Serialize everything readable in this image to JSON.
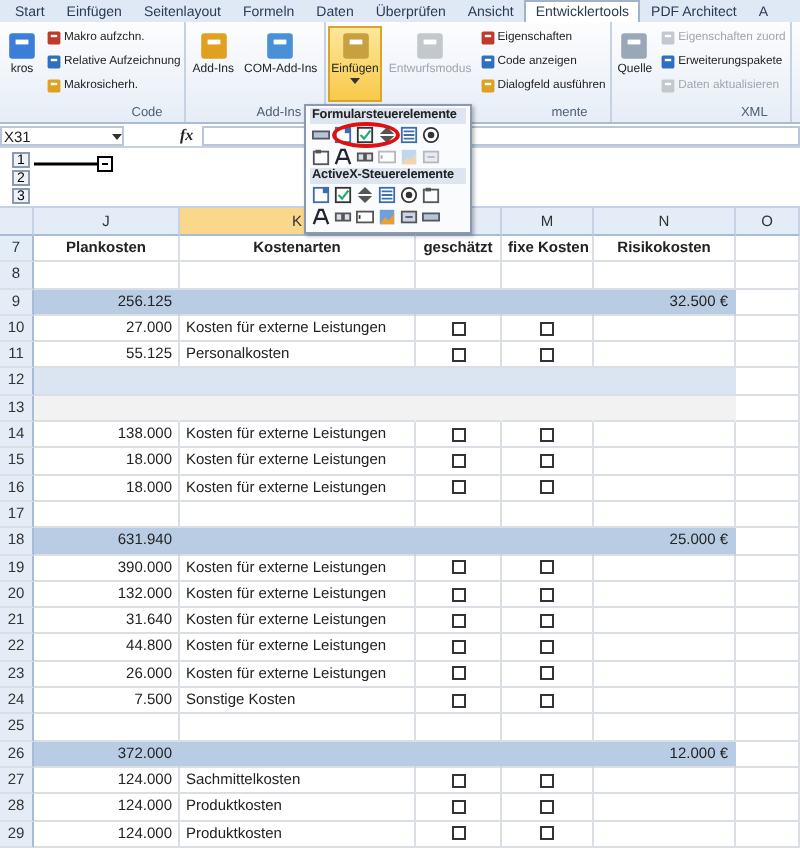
{
  "tabs": [
    {
      "label": "Start",
      "selected": false
    },
    {
      "label": "Einfügen",
      "selected": false
    },
    {
      "label": "Seitenlayout",
      "selected": false
    },
    {
      "label": "Formeln",
      "selected": false
    },
    {
      "label": "Daten",
      "selected": false
    },
    {
      "label": "Überprüfen",
      "selected": false
    },
    {
      "label": "Ansicht",
      "selected": false
    },
    {
      "label": "Entwicklertools",
      "selected": true
    },
    {
      "label": "PDF Architect",
      "selected": false
    },
    {
      "label": "A",
      "selected": false
    }
  ],
  "ribbon": [
    {
      "label": "Code",
      "large": [
        {
          "label": "kros",
          "selected": false,
          "disabled": false
        }
      ],
      "small": [
        {
          "label": "Makro aufzchn.",
          "disabled": false
        },
        {
          "label": "Relative Aufzeichnung",
          "disabled": false
        },
        {
          "label": "Makrosicherh.",
          "disabled": false
        }
      ]
    },
    {
      "label": "Add-Ins",
      "large": [
        {
          "label": "Add-Ins",
          "selected": false,
          "disabled": false
        },
        {
          "label": "COM-Add-Ins",
          "selected": false,
          "disabled": false
        }
      ]
    },
    {
      "label": "mente",
      "large": [
        {
          "label": "Einfügen",
          "selected": true,
          "disabled": false
        },
        {
          "label": "Entwurfsmodus",
          "selected": false,
          "disabled": true
        }
      ],
      "small": [
        {
          "label": "Eigenschaften",
          "disabled": false
        },
        {
          "label": "Code anzeigen",
          "disabled": false
        },
        {
          "label": "Dialogfeld ausführen",
          "disabled": false
        }
      ]
    },
    {
      "label": "XML",
      "large": [
        {
          "label": "Quelle",
          "selected": false,
          "disabled": false
        }
      ],
      "small": [
        {
          "label": "Eigenschaften zuord",
          "disabled": true
        },
        {
          "label": "Erweiterungspakete",
          "disabled": false
        },
        {
          "label": "Daten aktualisieren",
          "disabled": true
        }
      ]
    }
  ],
  "formula_bar": {
    "name_box": "X31",
    "function_label": "fx"
  },
  "outline": {
    "levels": [
      "1",
      "2",
      "3"
    ]
  },
  "dropdown": {
    "sections": [
      {
        "title": "Formularsteuerelemente"
      },
      {
        "title": "ActiveX-Steuerelemente"
      }
    ]
  },
  "columns": [
    {
      "letter": "J",
      "selected": false
    },
    {
      "letter": "K",
      "selected": true
    },
    {
      "selected": false
    },
    {
      "letter": "M",
      "selected": false
    },
    {
      "letter": "N",
      "selected": false
    },
    {
      "letter": "O",
      "selected": false
    }
  ],
  "rows": [
    {
      "row": "7",
      "kind": "header",
      "cells": [
        "Plankosten",
        "Kostenarten",
        "geschätzt",
        "fixe Kosten",
        "Risikokosten"
      ]
    },
    {
      "row": "8",
      "kind": "blank"
    },
    {
      "row": "9",
      "kind": "group",
      "plan": "256.125",
      "risk": "32.500 €"
    },
    {
      "row": "10",
      "kind": "item",
      "plan": "27.000",
      "type": "Kosten für externe Leistungen",
      "estimated": false,
      "fixed": false
    },
    {
      "row": "11",
      "kind": "item",
      "plan": "55.125",
      "type": "Personalkosten",
      "estimated": false,
      "fixed": false
    },
    {
      "row": "12",
      "kind": "band"
    },
    {
      "row": "13",
      "kind": "shade"
    },
    {
      "row": "14",
      "kind": "item",
      "plan": "138.000",
      "type": "Kosten für externe Leistungen",
      "estimated": false,
      "fixed": false
    },
    {
      "row": "15",
      "kind": "item",
      "plan": "18.000",
      "type": "Kosten für externe Leistungen",
      "estimated": false,
      "fixed": false
    },
    {
      "row": "16",
      "kind": "item",
      "plan": "18.000",
      "type": "Kosten für externe Leistungen",
      "estimated": false,
      "fixed": false
    },
    {
      "row": "17",
      "kind": "blank"
    },
    {
      "row": "18",
      "kind": "group",
      "plan": "631.940",
      "risk": "25.000 €"
    },
    {
      "row": "19",
      "kind": "item",
      "plan": "390.000",
      "type": "Kosten für externe Leistungen",
      "estimated": false,
      "fixed": false
    },
    {
      "row": "20",
      "kind": "item",
      "plan": "132.000",
      "type": "Kosten für externe Leistungen",
      "estimated": false,
      "fixed": false
    },
    {
      "row": "21",
      "kind": "item",
      "plan": "31.640",
      "type": "Kosten für externe Leistungen",
      "estimated": false,
      "fixed": false
    },
    {
      "row": "22",
      "kind": "item",
      "plan": "44.800",
      "type": "Kosten für externe Leistungen",
      "estimated": false,
      "fixed": false
    },
    {
      "row": "23",
      "kind": "item",
      "plan": "26.000",
      "type": "Kosten für externe Leistungen",
      "estimated": false,
      "fixed": false
    },
    {
      "row": "24",
      "kind": "item",
      "plan": "7.500",
      "type": "Sonstige Kosten",
      "estimated": false,
      "fixed": false
    },
    {
      "row": "25",
      "kind": "blank"
    },
    {
      "row": "26",
      "kind": "group",
      "plan": "372.000",
      "risk": "12.000 €"
    },
    {
      "row": "27",
      "kind": "item",
      "plan": "124.000",
      "type": "Sachmittelkosten",
      "estimated": false,
      "fixed": false
    },
    {
      "row": "28",
      "kind": "item",
      "plan": "124.000",
      "type": "Produktkosten",
      "estimated": false,
      "fixed": false
    },
    {
      "row": "29",
      "kind": "item",
      "plan": "124.000",
      "type": "Produktkosten",
      "estimated": false,
      "fixed": false
    }
  ]
}
